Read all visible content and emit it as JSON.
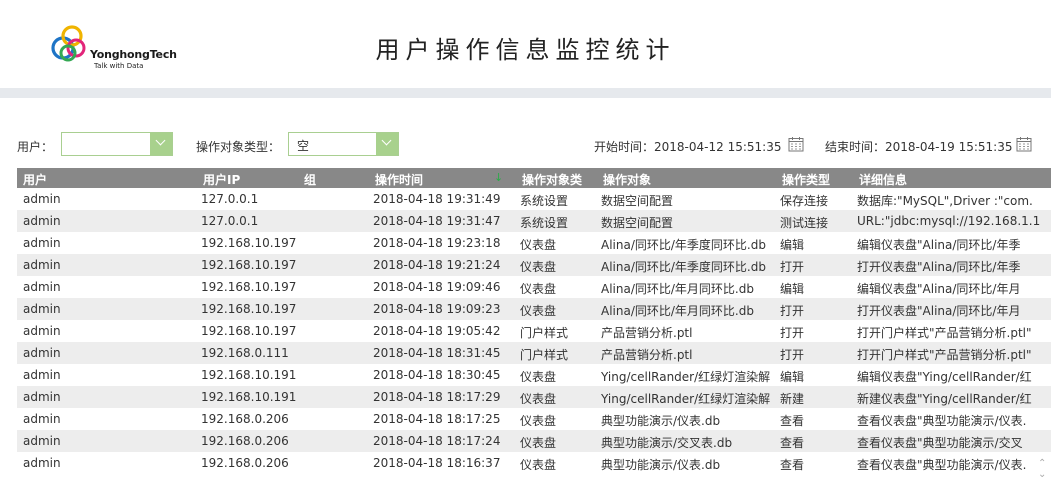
{
  "header": {
    "logo_name": "YonghongTech",
    "logo_tagline": "Talk with Data",
    "title": "用户操作信息监控统计"
  },
  "filters": {
    "user_label": "用户：",
    "user_value": "",
    "object_type_label": "操作对象类型：",
    "object_type_value": "空",
    "start_label": "开始时间：",
    "start_value": "2018-04-12 15:51:35",
    "end_label": "结束时间：",
    "end_value": "2018-04-19 15:51:35"
  },
  "colors": {
    "accent": "#a8d18d",
    "header_bar": "#888888",
    "sort_arrow": "#2ea94a"
  },
  "table": {
    "columns": [
      "用户",
      "用户IP",
      "组",
      "操作时间",
      "操作对象类",
      "操作对象",
      "操作类型",
      "详细信息"
    ],
    "sort_column": "操作时间",
    "rows": [
      [
        "admin",
        "127.0.0.1",
        "",
        "2018-04-18 19:31:49",
        "系统设置",
        "数据空间配置",
        "保存连接",
        "数据库:\"MySQL\",Driver :\"com."
      ],
      [
        "admin",
        "127.0.0.1",
        "",
        "2018-04-18 19:31:47",
        "系统设置",
        "数据空间配置",
        "测试连接",
        "URL:\"jdbc:mysql://192.168.1.1"
      ],
      [
        "admin",
        "192.168.10.197",
        "",
        "2018-04-18 19:23:18",
        "仪表盘",
        "Alina/同环比/年季度同环比.db",
        "编辑",
        "编辑仪表盘\"Alina/同环比/年季"
      ],
      [
        "admin",
        "192.168.10.197",
        "",
        "2018-04-18 19:21:24",
        "仪表盘",
        "Alina/同环比/年季度同环比.db",
        "打开",
        "打开仪表盘\"Alina/同环比/年季"
      ],
      [
        "admin",
        "192.168.10.197",
        "",
        "2018-04-18 19:09:46",
        "仪表盘",
        "Alina/同环比/年月同环比.db",
        "编辑",
        "编辑仪表盘\"Alina/同环比/年月"
      ],
      [
        "admin",
        "192.168.10.197",
        "",
        "2018-04-18 19:09:23",
        "仪表盘",
        "Alina/同环比/年月同环比.db",
        "打开",
        "打开仪表盘\"Alina/同环比/年月"
      ],
      [
        "admin",
        "192.168.10.197",
        "",
        "2018-04-18 19:05:42",
        "门户样式",
        "产品营销分析.ptl",
        "打开",
        "打开门户样式\"产品营销分析.ptl\""
      ],
      [
        "admin",
        "192.168.0.111",
        "",
        "2018-04-18 18:31:45",
        "门户样式",
        "产品营销分析.ptl",
        "打开",
        "打开门户样式\"产品营销分析.ptl\""
      ],
      [
        "admin",
        "192.168.10.191",
        "",
        "2018-04-18 18:30:45",
        "仪表盘",
        "Ying/cellRander/红绿灯渲染解",
        "编辑",
        "编辑仪表盘\"Ying/cellRander/红"
      ],
      [
        "admin",
        "192.168.10.191",
        "",
        "2018-04-18 18:17:29",
        "仪表盘",
        "Ying/cellRander/红绿灯渲染解",
        "新建",
        "新建仪表盘\"Ying/cellRander/红"
      ],
      [
        "admin",
        "192.168.0.206",
        "",
        "2018-04-18 18:17:25",
        "仪表盘",
        "典型功能演示/仪表.db",
        "查看",
        "查看仪表盘\"典型功能演示/仪表."
      ],
      [
        "admin",
        "192.168.0.206",
        "",
        "2018-04-18 18:17:24",
        "仪表盘",
        "典型功能演示/交叉表.db",
        "查看",
        "查看仪表盘\"典型功能演示/交叉"
      ],
      [
        "admin",
        "192.168.0.206",
        "",
        "2018-04-18 18:16:37",
        "仪表盘",
        "典型功能演示/仪表.db",
        "查看",
        "查看仪表盘\"典型功能演示/仪表."
      ]
    ]
  }
}
